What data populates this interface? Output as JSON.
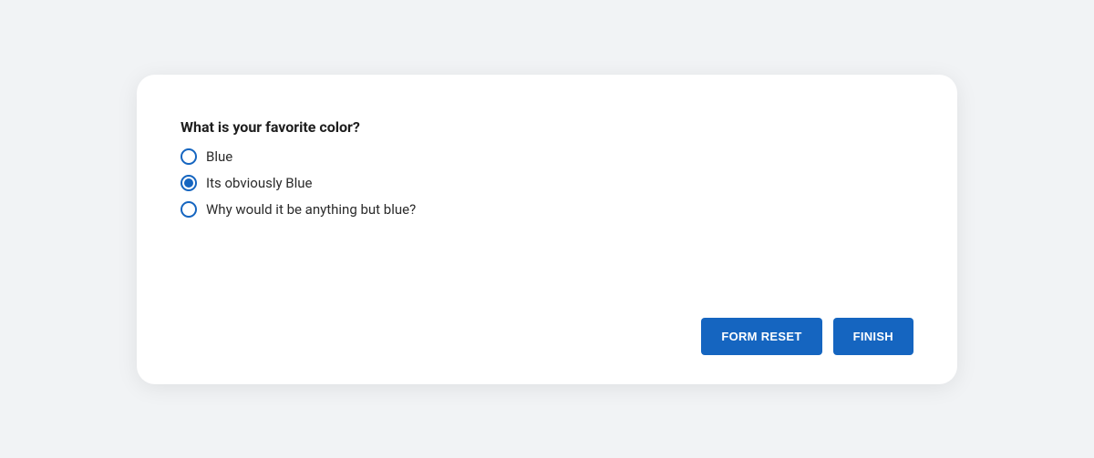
{
  "form": {
    "question": "What is your favorite color?",
    "options": [
      {
        "label": "Blue",
        "selected": false
      },
      {
        "label": "Its obviously Blue",
        "selected": true
      },
      {
        "label": "Why would it be anything but blue?",
        "selected": false
      }
    ]
  },
  "buttons": {
    "reset": "FORM RESET",
    "finish": "FINISH"
  }
}
